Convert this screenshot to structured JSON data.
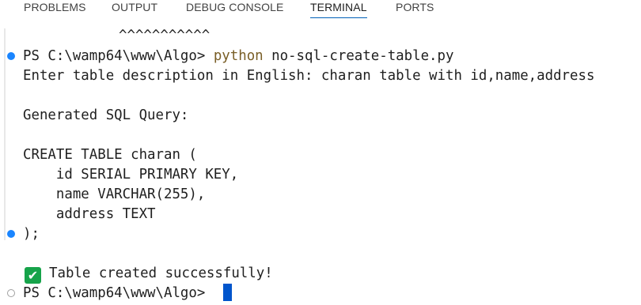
{
  "tabs": [
    {
      "label": "PROBLEMS",
      "active": false
    },
    {
      "label": "OUTPUT",
      "active": false
    },
    {
      "label": "DEBUG CONSOLE",
      "active": false
    },
    {
      "label": "TERMINAL",
      "active": true
    },
    {
      "label": "PORTS",
      "active": false
    }
  ],
  "terminal": {
    "carets": "^^^^^^^^^^^",
    "prompt1": "PS C:\\wamp64\\www\\Algo> ",
    "command_name": "python",
    "command_args": " no-sql-create-table.py",
    "input_line": "Enter table description in English: charan table with id,name,address",
    "generated_label": "Generated SQL Query:",
    "sql_lines": [
      "CREATE TABLE charan (",
      "    id SERIAL PRIMARY KEY,",
      "    name VARCHAR(255),",
      "    address TEXT",
      ");"
    ],
    "success_icon": "✔",
    "success_text": "Table created successfully!",
    "prompt2": "PS C:\\wamp64\\www\\Algo> "
  },
  "colors": {
    "accent": "#005fb8",
    "command": "#795e26",
    "success_mark": "#16a34a",
    "decoration_success": "#1a85ff",
    "cursor": "#0055cc"
  }
}
